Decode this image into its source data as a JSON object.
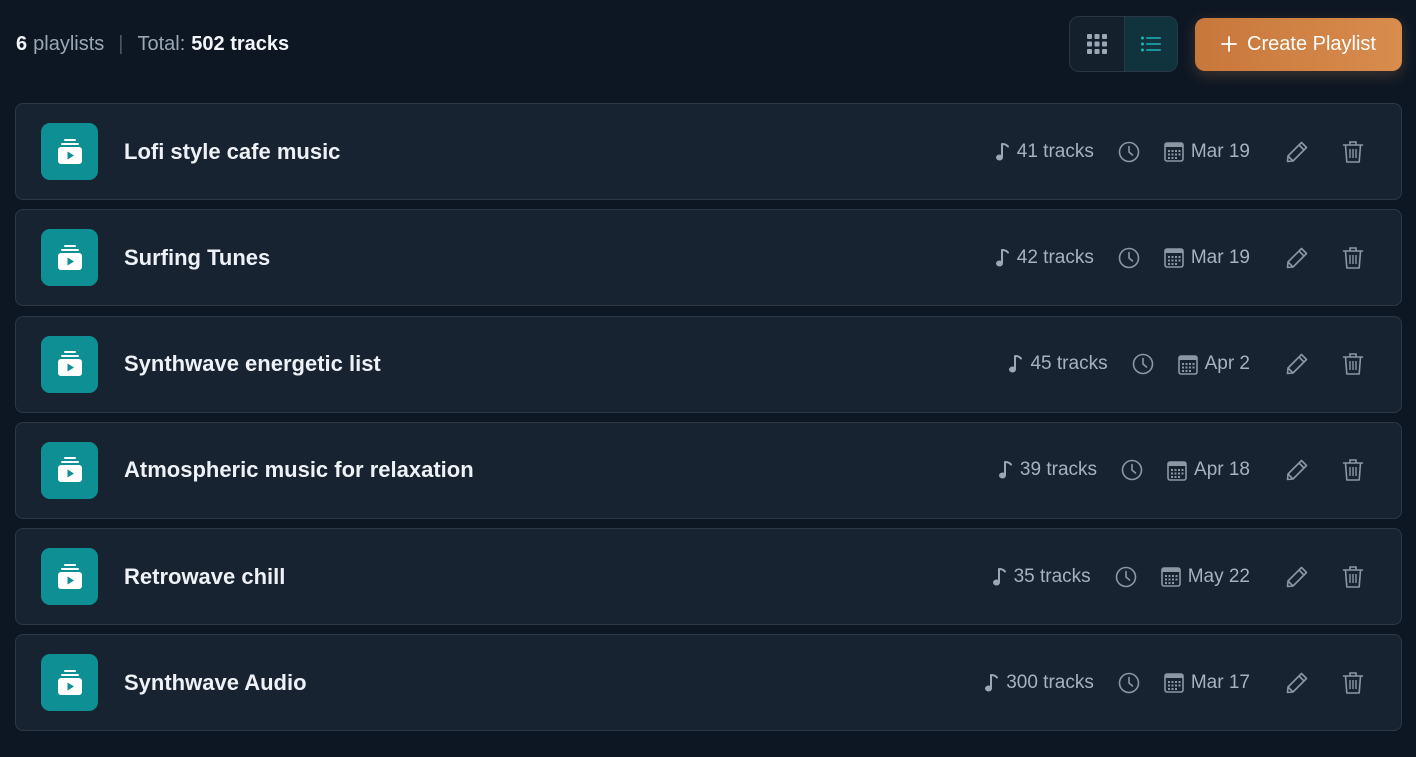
{
  "summary": {
    "playlist_count": "6",
    "playlist_label": "playlists",
    "separator": "|",
    "total_label": "Total:",
    "total_value": "502 tracks"
  },
  "toolbar": {
    "grid_view_icon": "grid-icon",
    "list_view_icon": "list-icon",
    "active_view": "list",
    "create_label": "Create Playlist"
  },
  "colors": {
    "background": "#0d1724",
    "card": "#172331",
    "accent_teal": "#0e8f94",
    "accent_orange": "#d88c4e"
  },
  "playlists": [
    {
      "name": "Lofi style cafe music",
      "tracks": "41 tracks",
      "date": "Mar 19"
    },
    {
      "name": "Surfing Tunes",
      "tracks": "42 tracks",
      "date": "Mar 19"
    },
    {
      "name": "Synthwave energetic list",
      "tracks": "45 tracks",
      "date": "Apr 2"
    },
    {
      "name": "Atmospheric music for relaxation",
      "tracks": "39 tracks",
      "date": "Apr 18"
    },
    {
      "name": "Retrowave chill",
      "tracks": "35 tracks",
      "date": "May 22"
    },
    {
      "name": "Synthwave Audio",
      "tracks": "300 tracks",
      "date": "Mar 17"
    }
  ]
}
